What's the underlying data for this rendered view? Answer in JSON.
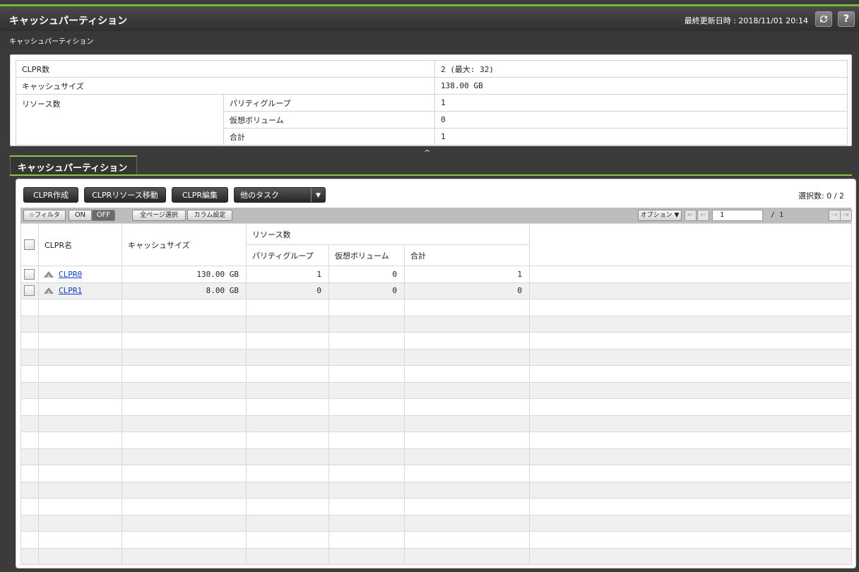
{
  "window": {
    "title": "キャッシュパーティション",
    "last_updated": "最終更新日時 : 2018/11/01 20:14",
    "refresh_icon": "refresh-icon",
    "help_label": "?"
  },
  "breadcrumb": "キャッシュパーティション",
  "summary": {
    "clpr_count_label": "CLPR数",
    "clpr_count_value": "2 (最大: 32)",
    "cache_size_label": "キャッシュサイズ",
    "cache_size_value": "138.00 GB",
    "resources_label": "リソース数",
    "parity_label": "パリティグループ",
    "parity_value": "1",
    "virtual_label": "仮想ボリューム",
    "virtual_value": "0",
    "total_label": "合計",
    "total_value": "1"
  },
  "tab": {
    "label": "キャッシュパーティション"
  },
  "toolbar": {
    "create": "CLPR作成",
    "move": "CLPRリソース移動",
    "edit": "CLPR編集",
    "other": "他のタスク",
    "selected": "選択数: 0 / 2"
  },
  "filterbar": {
    "filter": "☆フィルタ",
    "on": "ON",
    "off": "OFF",
    "select_all": "全ページ選択",
    "column_settings": "カラム設定",
    "options": "オプション ▼",
    "page": "1",
    "page_total": "/ 1"
  },
  "columns": {
    "name": "CLPR名",
    "cache_size": "キャッシュサイズ",
    "resources": "リソース数",
    "parity": "パリティグループ",
    "virtual": "仮想ボリューム",
    "total": "合計"
  },
  "rows": [
    {
      "name": "CLPR0",
      "cache_size": "130.00 GB",
      "parity": "1",
      "virtual": "0",
      "total": "1"
    },
    {
      "name": "CLPR1",
      "cache_size": "8.00 GB",
      "parity": "0",
      "virtual": "0",
      "total": "0"
    }
  ]
}
